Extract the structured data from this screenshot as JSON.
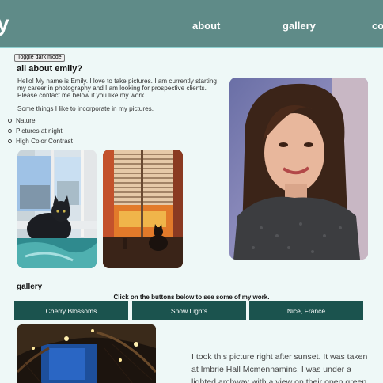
{
  "header": {
    "logo": "y",
    "nav": [
      "about",
      "gallery",
      "co"
    ]
  },
  "toggle_label": "Toggle dark mode",
  "about": {
    "heading": "all about emily?",
    "bio": "Hello! My name is Emily. I love to take pictures. I am currently starting my career in photography and I am looking for prospective clients. Please contact me below if you like my work.",
    "incorporate": "Some things I like to incorporate in my pictures.",
    "likes": [
      "Nature",
      "Pictures at night",
      "High Color Contrast"
    ]
  },
  "gallery": {
    "heading": "gallery",
    "instructions": "Click on the buttons below to see some of my work.",
    "buttons": [
      "Cherry Blossoms",
      "Snow Lights",
      "Nice, France"
    ],
    "caption": "I took this picture right after sunset. It was taken at Imbrie Hall Mcmennamins. I was under a lighted archway with a view on their open green"
  },
  "colors": {
    "header_bg": "#5f8b88",
    "page_bg": "#eef8f7",
    "button_bg": "#1b534e"
  }
}
